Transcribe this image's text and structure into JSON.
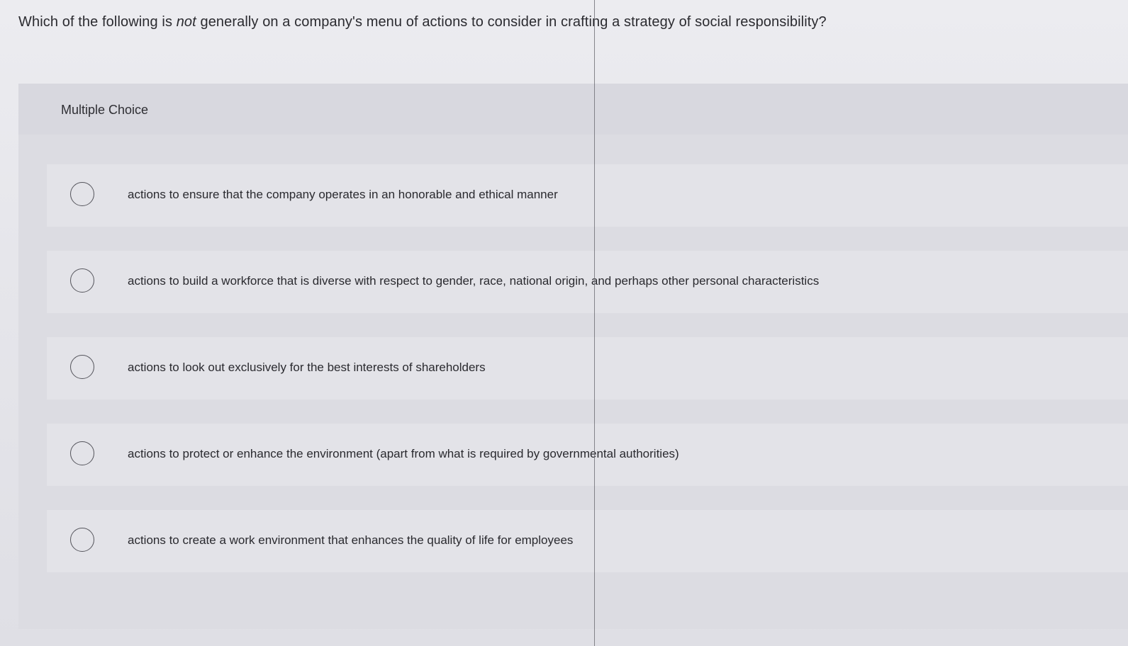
{
  "question": {
    "prefix": "Which of the following is ",
    "emphasis": "not",
    "suffix": " generally on a company's menu of actions to consider in crafting a strategy of social responsibility?"
  },
  "panel": {
    "title": "Multiple Choice"
  },
  "options": [
    {
      "label": "actions to ensure that the company operates in an honorable and ethical manner",
      "selected": false
    },
    {
      "label": "actions to build a workforce that is diverse with respect to gender, race, national origin, and perhaps other personal characteristics",
      "selected": false
    },
    {
      "label": "actions to look out exclusively for the best interests of shareholders",
      "selected": false
    },
    {
      "label": "actions to protect or enhance the environment (apart from what is required by governmental authorities)",
      "selected": false
    },
    {
      "label": "actions to create a work environment that enhances the quality of life for employees",
      "selected": false
    }
  ]
}
